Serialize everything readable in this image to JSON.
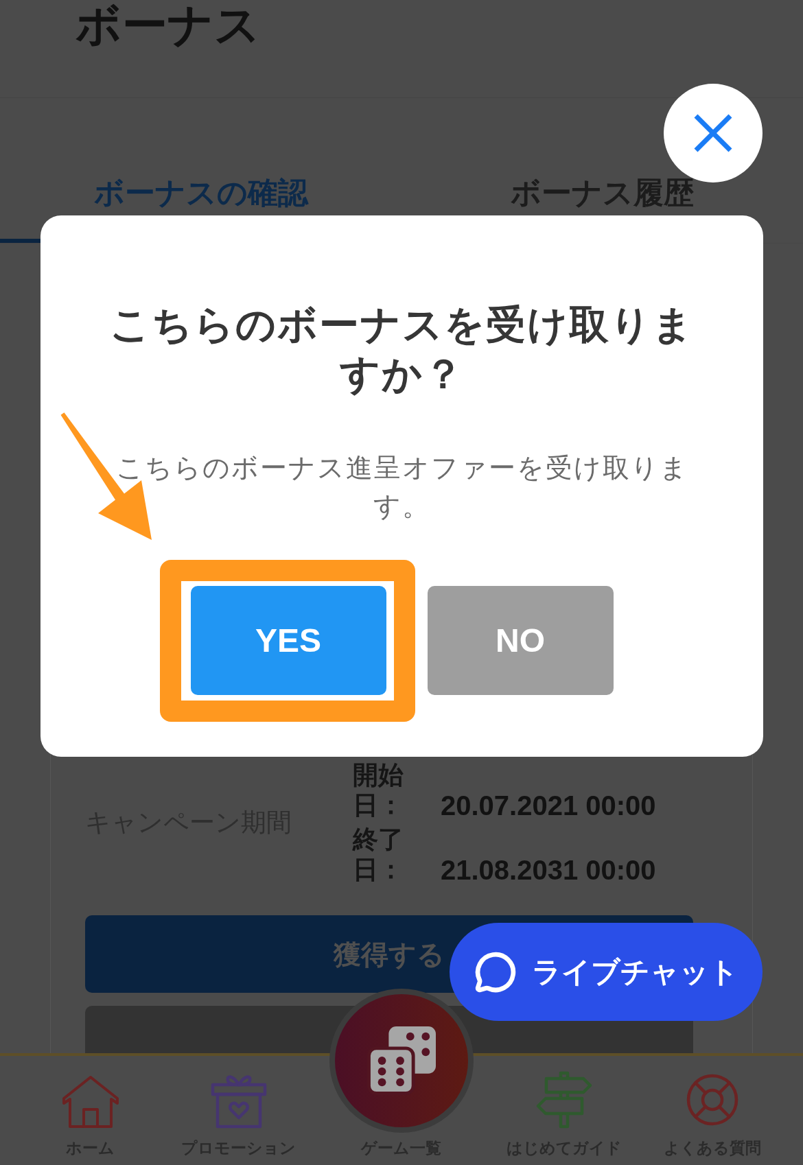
{
  "header": {
    "title": "ボーナス"
  },
  "tabs": [
    {
      "label": "ボーナスの確認",
      "selected": true
    },
    {
      "label": "ボーナス履歴",
      "selected": false
    }
  ],
  "campaign": {
    "label": "キャンペーン期間",
    "periods": [
      {
        "label": "開始日：",
        "value": "20.07.2021 00:00"
      },
      {
        "label": "終了日：",
        "value": "21.08.2031 00:00"
      }
    ]
  },
  "actions": [
    {
      "label": "獲得する",
      "kind": "primary"
    },
    {
      "kind": "secondary"
    }
  ],
  "dialog": {
    "title": "こちらのボーナスを受け取りますか？",
    "message": "こちらのボーナス進呈オファーを受け取ります。",
    "buttons": [
      {
        "label": "YES",
        "kind": "primary",
        "highlighted": true
      },
      {
        "label": "NO",
        "kind": "secondary",
        "highlighted": false
      }
    ]
  },
  "live_chat": {
    "label": "ライブチャット"
  },
  "bottom_nav": [
    {
      "label": "ホーム",
      "kind": "tab"
    },
    {
      "label": "プロモーション",
      "kind": "tab"
    },
    {
      "label": "ゲーム一覧",
      "kind": "center"
    },
    {
      "label": "はじめてガイド",
      "kind": "tab"
    },
    {
      "label": "よくある質問",
      "kind": "tab"
    }
  ]
}
